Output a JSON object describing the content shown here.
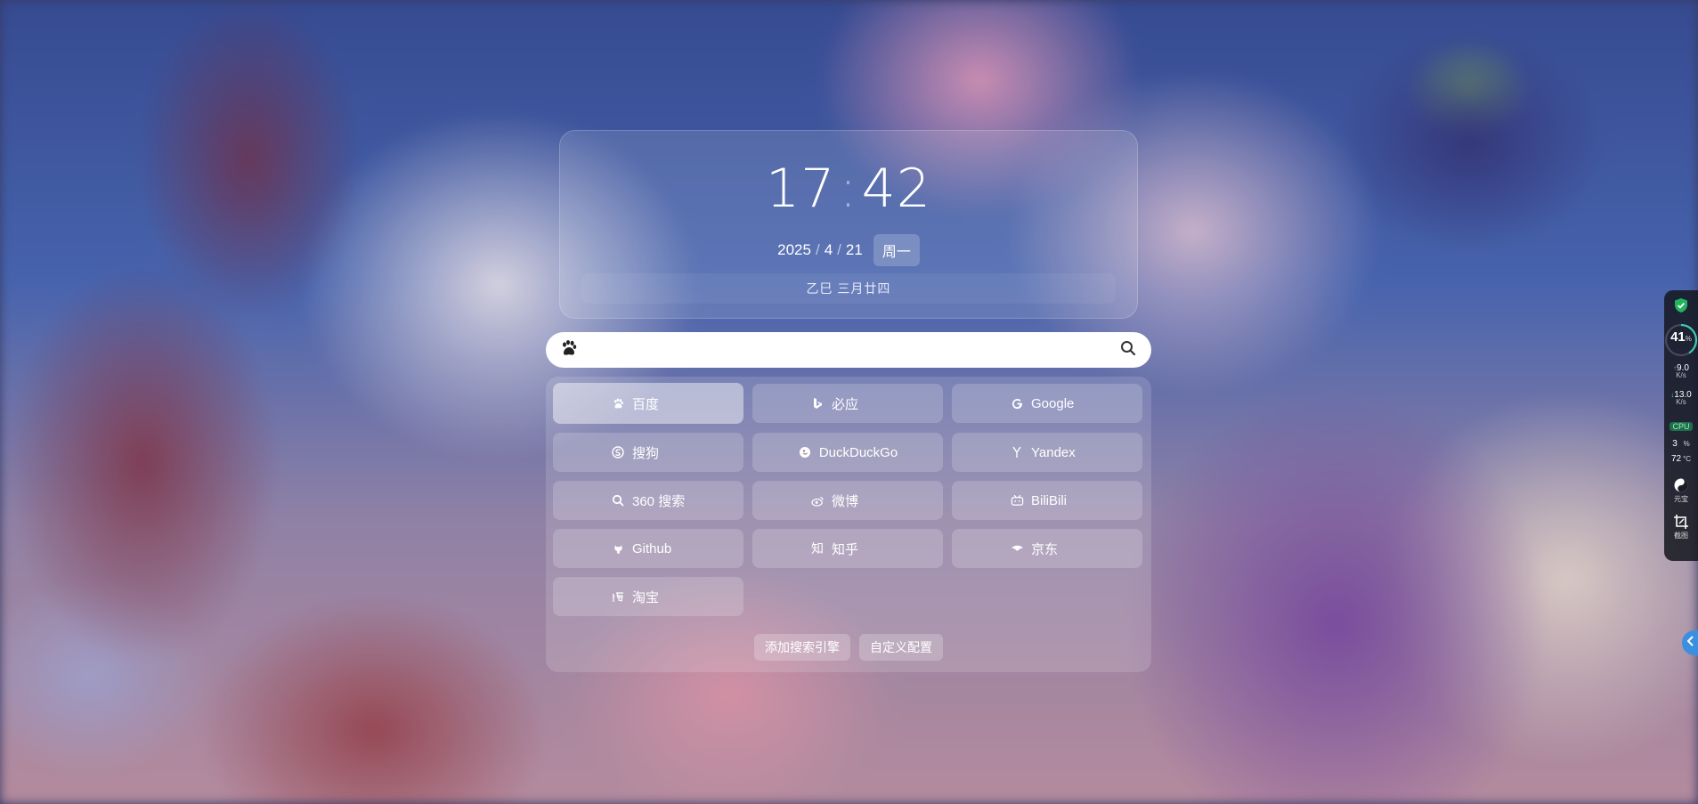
{
  "clock": {
    "hours": "17",
    "colon": ":",
    "minutes": "42",
    "date_year": "2025",
    "date_month": "4",
    "date_day": "21",
    "date_sep": "/",
    "weekday": "周一",
    "lunar": "乙巳  三月廿四"
  },
  "search": {
    "placeholder": "",
    "value": "",
    "engine_icon": "baidu-paw-icon",
    "submit_icon": "search-icon"
  },
  "engines": [
    {
      "label": "百度",
      "icon": "baidu-paw-icon",
      "active": true
    },
    {
      "label": "必应",
      "icon": "bing-icon",
      "active": false
    },
    {
      "label": "Google",
      "icon": "google-icon",
      "active": false
    },
    {
      "label": "搜狗",
      "icon": "sogou-icon",
      "active": false
    },
    {
      "label": "DuckDuckGo",
      "icon": "duckduckgo-icon",
      "active": false
    },
    {
      "label": "Yandex",
      "icon": "yandex-icon",
      "active": false
    },
    {
      "label": "360 搜索",
      "icon": "so360-icon",
      "active": false
    },
    {
      "label": "微博",
      "icon": "weibo-icon",
      "active": false
    },
    {
      "label": "BiliBili",
      "icon": "bilibili-icon",
      "active": false
    },
    {
      "label": "Github",
      "icon": "github-icon",
      "active": false
    },
    {
      "label": "知乎",
      "icon": "zhihu-icon",
      "active": false
    },
    {
      "label": "京东",
      "icon": "jd-icon",
      "active": false
    },
    {
      "label": "淘宝",
      "icon": "taobao-icon",
      "active": false
    }
  ],
  "actions": {
    "add_engine": "添加搜索引擎",
    "custom_config": "自定义配置"
  },
  "system_monitor": {
    "memory_percent": "41",
    "memory_unit": "%",
    "upload_speed": "9.0",
    "download_speed": "13.0",
    "speed_unit": "K/s",
    "cpu_label": "CPU",
    "cpu_usage": "3",
    "cpu_usage_unit": "%",
    "cpu_temp": "72",
    "cpu_temp_unit": "°C",
    "tool1_label": "元宝",
    "tool2_label": "截图",
    "memory_fill": 0.41
  },
  "colors": {
    "accent_blue": "#3a8fe0",
    "shield_green": "#22b35e"
  }
}
